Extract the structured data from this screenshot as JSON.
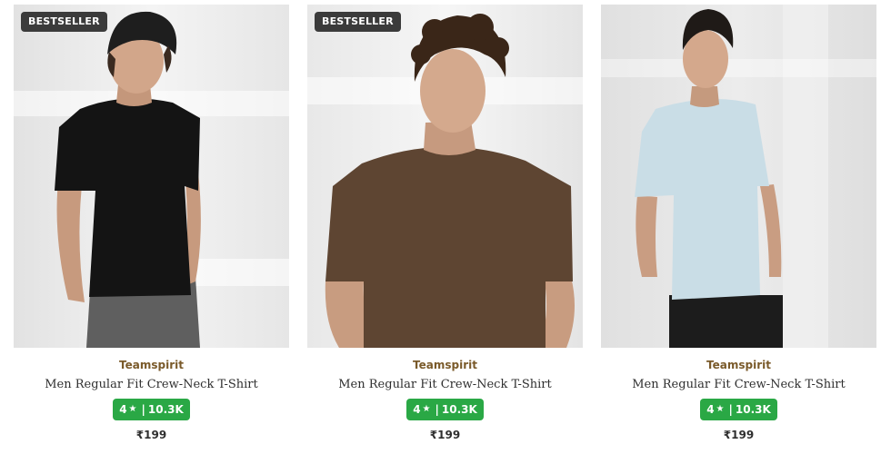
{
  "products": [
    {
      "badge": "BESTSELLER",
      "brand": "Teamspirit",
      "title": "Men Regular Fit Crew-Neck T-Shirt",
      "rating": "4",
      "rating_count": "10.3K",
      "price": "₹199",
      "shirt_color": "#141414",
      "image_desc": "model-black-tshirt"
    },
    {
      "badge": "BESTSELLER",
      "brand": "Teamspirit",
      "title": "Men Regular Fit Crew-Neck T-Shirt",
      "rating": "4",
      "rating_count": "10.3K",
      "price": "₹199",
      "shirt_color": "#5e4532",
      "image_desc": "model-brown-tshirt"
    },
    {
      "badge": "",
      "brand": "Teamspirit",
      "title": "Men Regular Fit Crew-Neck T-Shirt",
      "rating": "4",
      "rating_count": "10.3K",
      "price": "₹199",
      "shirt_color": "#c9dde6",
      "image_desc": "model-light-blue-tshirt"
    }
  ],
  "colors": {
    "brand_text": "#7a5a2a",
    "rating_bg": "#2aa845",
    "badge_bg": "#3b3b3b"
  },
  "icons": {
    "star": "star-icon"
  }
}
